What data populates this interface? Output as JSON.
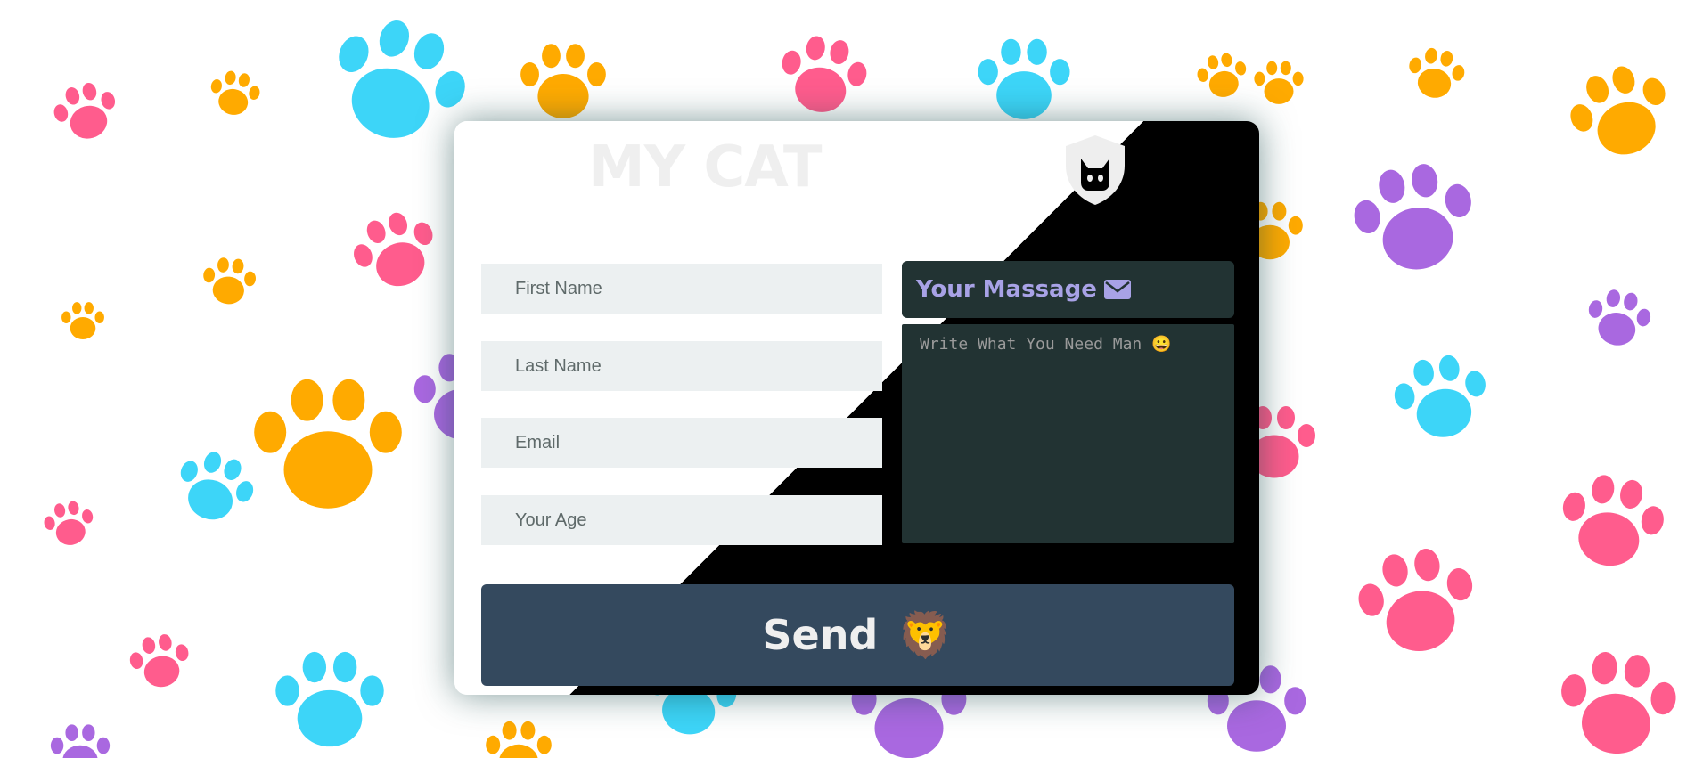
{
  "form": {
    "title": "MY CAT",
    "first_name_placeholder": "First Name",
    "last_name_placeholder": "Last Name",
    "email_placeholder": "Email",
    "age_placeholder": "Your Age",
    "message_label": "Your Massage",
    "message_placeholder": "Write What You Need Man 😀",
    "send_label": "Send",
    "send_emoji": "🦁"
  },
  "icons": {
    "logo": "cat-shield-icon",
    "message": "envelope-icon"
  },
  "colors": {
    "background": "#ffffff",
    "card_dark": "#000000",
    "input_bg": "#ecf0f1",
    "message_bg": "#223333",
    "message_label": "#a8a2e6",
    "send_bg": "#34495e",
    "title": "#efefef",
    "paw_blue": "#3dd5f8",
    "paw_orange": "#ffaa00",
    "paw_pink": "#ff5c8d",
    "paw_purple": "#a968e0"
  }
}
